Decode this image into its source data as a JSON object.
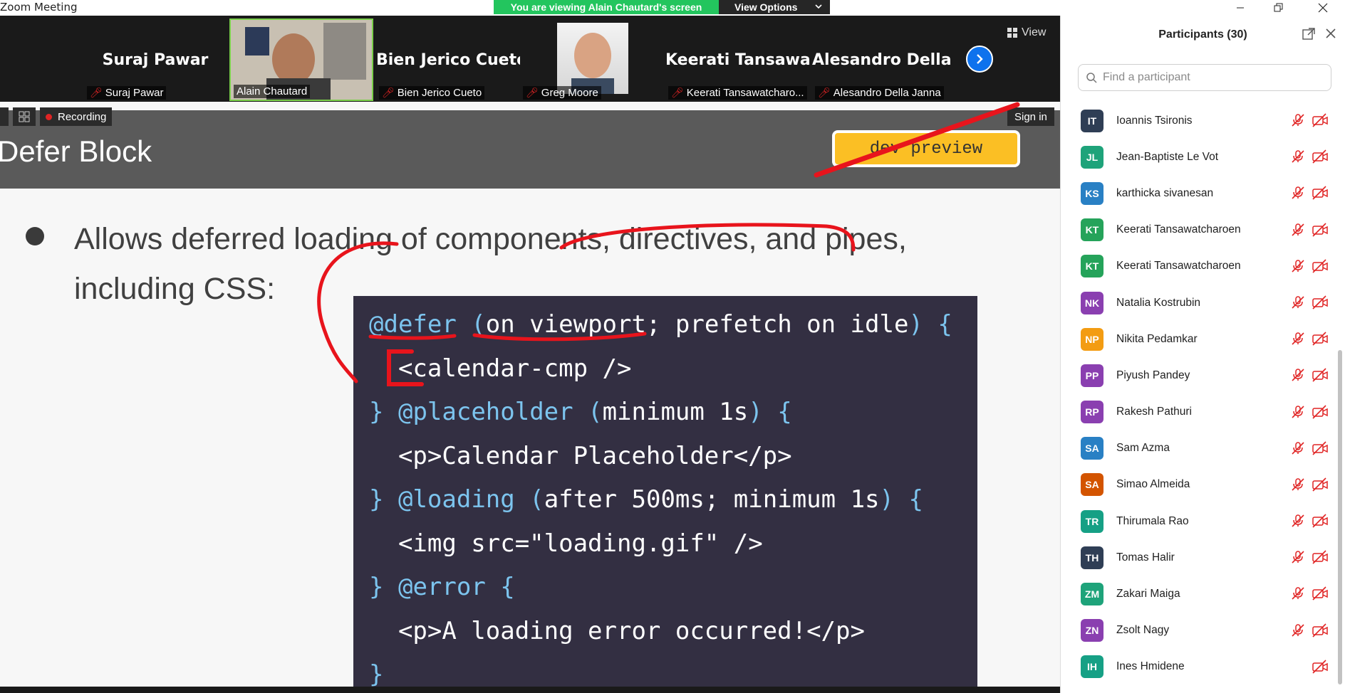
{
  "window": {
    "title": "Zoom Meeting",
    "banner": "You are viewing Alain Chautard's screen",
    "view_options": "View Options"
  },
  "video_strip": {
    "view_label": "View",
    "tiles": [
      {
        "big_name": "Suraj Pawar",
        "caption": "Suraj Pawar",
        "muted": true
      },
      {
        "big_name": "",
        "caption": "Alain Chautard",
        "muted": false
      },
      {
        "big_name": "Bien Jerico Cueto",
        "caption": "Bien Jerico Cueto",
        "muted": true
      },
      {
        "big_name": "",
        "caption": "Greg Moore",
        "muted": true
      },
      {
        "big_name": "Keerati  Tansawa...",
        "caption": "Keerati Tansawatcharo...",
        "muted": true
      },
      {
        "big_name": "Alesandro  Della...",
        "caption": "Alesandro Della Janna",
        "muted": true
      }
    ]
  },
  "shared_screen": {
    "recording_label": "Recording",
    "sign_in": "Sign in",
    "slide_title": "Defer Block",
    "badge": "dev preview",
    "bullet_line1": "Allows deferred loading of components, directives, and pipes,",
    "bullet_line2": "including CSS:",
    "code_lines": [
      "@defer (on viewport; prefetch on idle) {",
      "  <calendar-cmp />",
      "} @placeholder (minimum 1s) {",
      "  <p>Calendar Placeholder</p>",
      "} @loading (after 500ms; minimum 1s) {",
      "  <img src=\"loading.gif\" />",
      "} @error {",
      "  <p>A loading error occurred!</p>",
      "}"
    ]
  },
  "participants": {
    "title": "Participants (30)",
    "search_placeholder": "Find a participant",
    "items": [
      {
        "initials": "IT",
        "name": "Ioannis Tsironis",
        "color": "#2f3e55",
        "mic_muted": true
      },
      {
        "initials": "JL",
        "name": "Jean-Baptiste Le Vot",
        "color": "#1ea37a",
        "mic_muted": true
      },
      {
        "initials": "KS",
        "name": "karthicka sivanesan",
        "color": "#2980c4",
        "mic_muted": true
      },
      {
        "initials": "KT",
        "name": "Keerati Tansawatcharoen",
        "color": "#25a35a",
        "mic_muted": true
      },
      {
        "initials": "KT",
        "name": "Keerati Tansawatcharoen",
        "color": "#25a35a",
        "mic_muted": true
      },
      {
        "initials": "NK",
        "name": "Natalia Kostrubin",
        "color": "#8a3fb0",
        "mic_muted": true
      },
      {
        "initials": "NP",
        "name": "Nikita Pedamkar",
        "color": "#f39c12",
        "mic_muted": true
      },
      {
        "initials": "PP",
        "name": "Piyush Pandey",
        "color": "#8a3fb0",
        "mic_muted": true
      },
      {
        "initials": "RP",
        "name": "Rakesh Pathuri",
        "color": "#8a3fb0",
        "mic_muted": true
      },
      {
        "initials": "SA",
        "name": "Sam Azma",
        "color": "#2980c4",
        "mic_muted": true
      },
      {
        "initials": "SA",
        "name": "Simao Almeida",
        "color": "#d35400",
        "mic_muted": true
      },
      {
        "initials": "TR",
        "name": "Thirumala Rao",
        "color": "#16a085",
        "mic_muted": true
      },
      {
        "initials": "TH",
        "name": "Tomas Halir",
        "color": "#2f3e55",
        "mic_muted": true
      },
      {
        "initials": "ZM",
        "name": "Zakari Maiga",
        "color": "#1ea37a",
        "mic_muted": true
      },
      {
        "initials": "ZN",
        "name": "Zsolt Nagy",
        "color": "#8a3fb0",
        "mic_muted": true
      },
      {
        "initials": "IH",
        "name": "Ines Hmidene",
        "color": "#16a085",
        "mic_muted": false
      }
    ]
  },
  "colors": {
    "accent": "#0e72ed",
    "banner_green": "#23c55e",
    "muted_red": "#e02424",
    "code_bg": "#332f42",
    "code_keyword": "#7cc4ee",
    "annotation_red": "#e8141c"
  }
}
